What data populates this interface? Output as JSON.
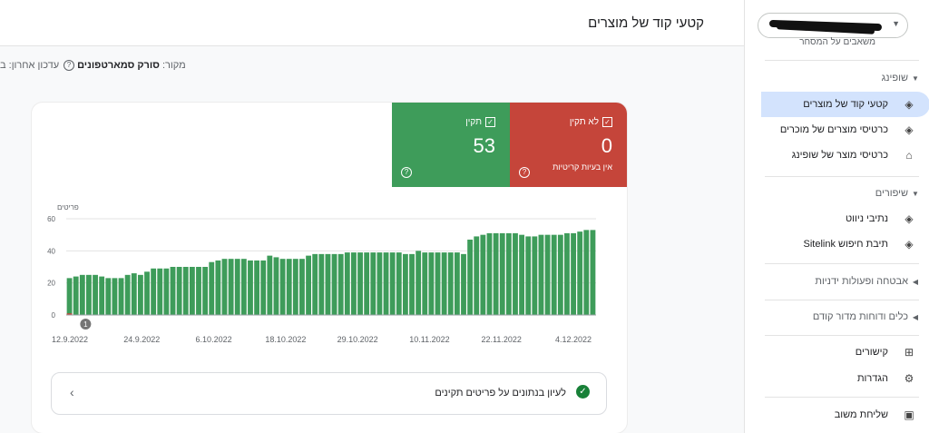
{
  "header": {
    "title": "קטעי קוד של מוצרים",
    "source_label": "מקור:",
    "source_value": "סורק סמארטפונים",
    "last_update": "עדכון אחרון: ב"
  },
  "tiles": {
    "invalid": {
      "label": "לא תקין",
      "value": "0",
      "sub": "אין בעיות קריטיות",
      "color": "#c5453a"
    },
    "valid": {
      "label": "תקין",
      "value": "53",
      "color": "#3e9c5a"
    }
  },
  "chart_data": {
    "type": "bar",
    "ylabel": "פריטים",
    "ylim": [
      0,
      60
    ],
    "yticks": [
      "0",
      "20",
      "40",
      "60"
    ],
    "xticks": [
      "12.9.2022",
      "24.9.2022",
      "6.10.2022",
      "18.10.2022",
      "29.10.2022",
      "10.11.2022",
      "22.11.2022",
      "4.12.2022"
    ],
    "annotation": "1",
    "series": [
      {
        "color": "#3e9c5a",
        "values": [
          23,
          24,
          25,
          25,
          25,
          24,
          23,
          23,
          23,
          25,
          26,
          25,
          27,
          29,
          29,
          29,
          30,
          30,
          30,
          30,
          30,
          30,
          33,
          34,
          35,
          35,
          35,
          35,
          34,
          34,
          34,
          37,
          36,
          35,
          35,
          35,
          35,
          37,
          38,
          38,
          38,
          38,
          38,
          39,
          39,
          39,
          39,
          39,
          39,
          39,
          39,
          39,
          38,
          38,
          40,
          39,
          39,
          39,
          39,
          39,
          39,
          38,
          47,
          49,
          50,
          51,
          51,
          51,
          51,
          51,
          50,
          49,
          49,
          50,
          50,
          50,
          50,
          51,
          51,
          52,
          53,
          53
        ]
      },
      {
        "color": "#c5453a",
        "values": [
          1,
          0,
          0,
          0,
          0,
          0,
          0,
          0,
          0,
          0,
          0,
          0,
          0,
          0,
          0,
          0,
          0,
          0,
          0,
          0,
          0,
          0,
          0,
          0,
          0,
          0,
          0,
          0,
          0,
          0,
          0,
          0,
          0,
          0,
          0,
          0,
          0,
          0,
          0,
          0,
          0,
          0,
          0,
          0,
          0,
          0,
          0,
          0,
          0,
          0,
          0,
          0,
          0,
          0,
          0,
          0,
          0,
          0,
          0,
          0,
          0,
          0,
          0,
          0,
          0,
          0,
          0,
          0,
          0,
          0,
          0,
          0,
          0,
          0,
          0,
          0,
          0,
          0,
          0,
          0,
          0,
          0
        ]
      }
    ]
  },
  "bottom": {
    "text": "לעיון בנתונים על פריטים תקינים"
  },
  "sidebar": {
    "cut_item": "משאבים על המסחר",
    "shopping_section": "שופינג",
    "shopping_items": [
      {
        "label": "קטעי קוד של מוצרים",
        "icon": "layers-icon"
      },
      {
        "label": "כרטיסי מוצרים של מוכרים",
        "icon": "layers-icon"
      },
      {
        "label": "כרטיסי מוצר של שופינג",
        "icon": "tag-icon"
      }
    ],
    "enhancements_section": "שיפורים",
    "enhancement_items": [
      {
        "label": "נתיבי ניווט",
        "icon": "layers-icon"
      },
      {
        "label": "תיבת חיפוש Sitelink",
        "icon": "layers-icon"
      }
    ],
    "security_section": "אבטחה ופעולות ידניות",
    "legacy_section": "כלים ודוחות מדור קודם",
    "links_label": "קישורים",
    "settings_label": "הגדרות",
    "feedback_label": "שליחת משוב"
  }
}
